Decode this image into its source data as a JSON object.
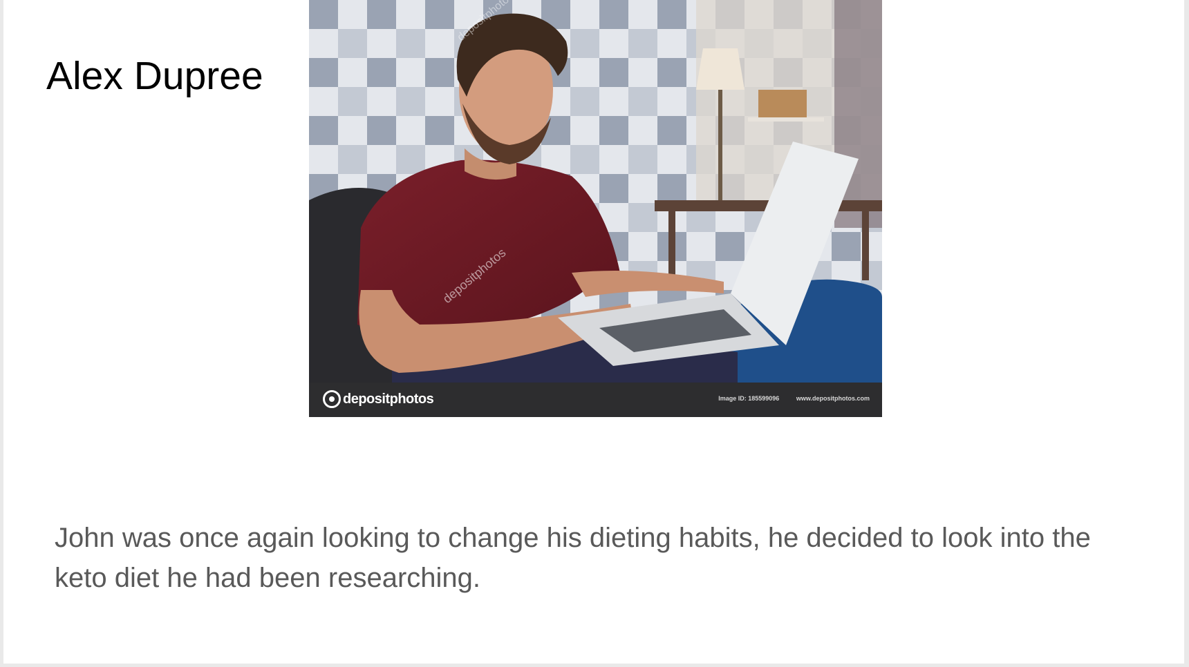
{
  "slide": {
    "title": "Alex Dupree",
    "caption": "John was once again looking to change his dieting habits, he decided to look into the keto diet he had been researching."
  },
  "photo": {
    "description_icon": "stock-photo",
    "watermark": {
      "brand": "depositphotos",
      "image_id": "Image ID: 185599096",
      "site": "www.depositphotos.com"
    }
  },
  "colors": {
    "title_text": "#000000",
    "caption_text": "#595959",
    "watermark_bar": "#2d2d2f"
  }
}
